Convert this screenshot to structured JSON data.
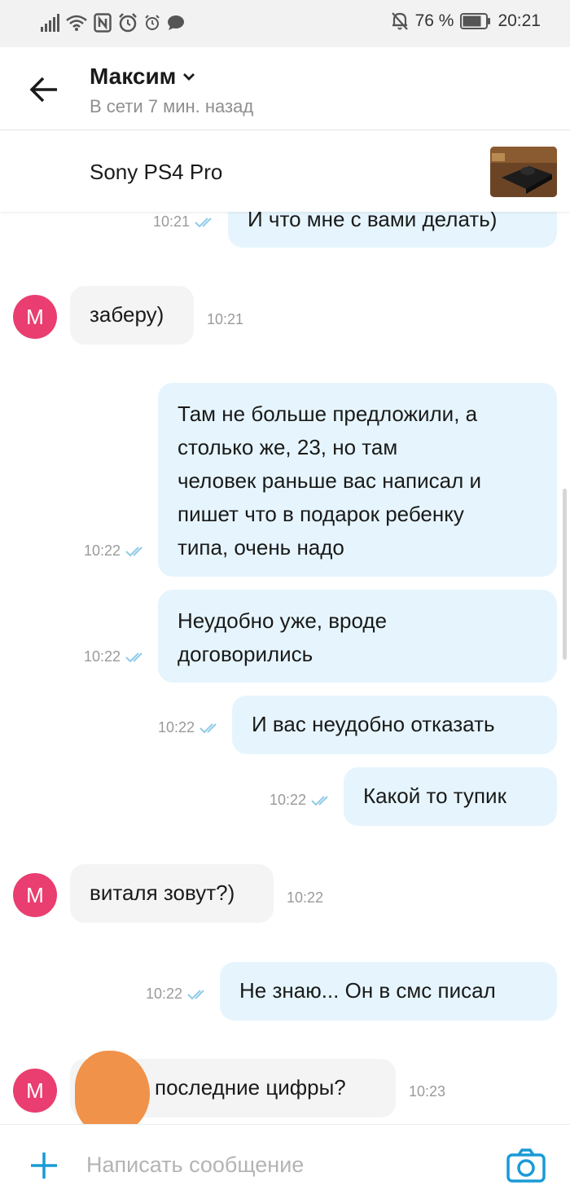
{
  "status_bar": {
    "battery_percent": "76 %",
    "time": "20:21"
  },
  "header": {
    "contact_name": "Максим",
    "contact_status": "В сети 7 мин. назад"
  },
  "product": {
    "title": "Sony PS4 Pro"
  },
  "messages": [
    {
      "direction": "out",
      "text": "И что мне с вами делать)",
      "time": "10:21",
      "read": true
    },
    {
      "direction": "in",
      "avatar": "М",
      "text": "заберу)",
      "time": "10:21"
    },
    {
      "direction": "out",
      "lines": [
        "Там не больше предложили, а",
        "столько же, 23, но там",
        "человек раньше вас написал и",
        "пишет что в подарок ребенку",
        "типа, очень надо"
      ],
      "time": "10:22",
      "read": true
    },
    {
      "direction": "out",
      "lines": [
        "Неудобно уже, вроде",
        "договорились"
      ],
      "time": "10:22",
      "read": true
    },
    {
      "direction": "out",
      "text": "И вас неудобно отказать",
      "time": "10:22",
      "read": true
    },
    {
      "direction": "out",
      "text": "Какой то тупик",
      "time": "10:22",
      "read": true
    },
    {
      "direction": "in",
      "avatar": "М",
      "text": "виталя зовут?)",
      "time": "10:22"
    },
    {
      "direction": "out",
      "text": "Не знаю... Он в смс писал",
      "time": "10:22",
      "read": true
    },
    {
      "direction": "in",
      "avatar": "М",
      "text": "последние цифры?",
      "time": "10:23"
    }
  ],
  "composer": {
    "placeholder": "Написать сообщение"
  },
  "colors": {
    "accent": "#1a9ad6",
    "outgoing_bubble": "#e6f5fd",
    "incoming_bubble": "#f4f4f4",
    "avatar": "#e93e6f",
    "read_ticks": "#8fcbe8",
    "redaction": "#f0924a"
  },
  "icons": [
    "signal-icon",
    "wifi-icon",
    "nfc-icon",
    "alarm-icon",
    "chat-notification-icon",
    "mute-bell-icon",
    "battery-icon",
    "back-arrow-icon",
    "chevron-down-icon",
    "double-check-icon",
    "plus-icon",
    "camera-icon"
  ]
}
